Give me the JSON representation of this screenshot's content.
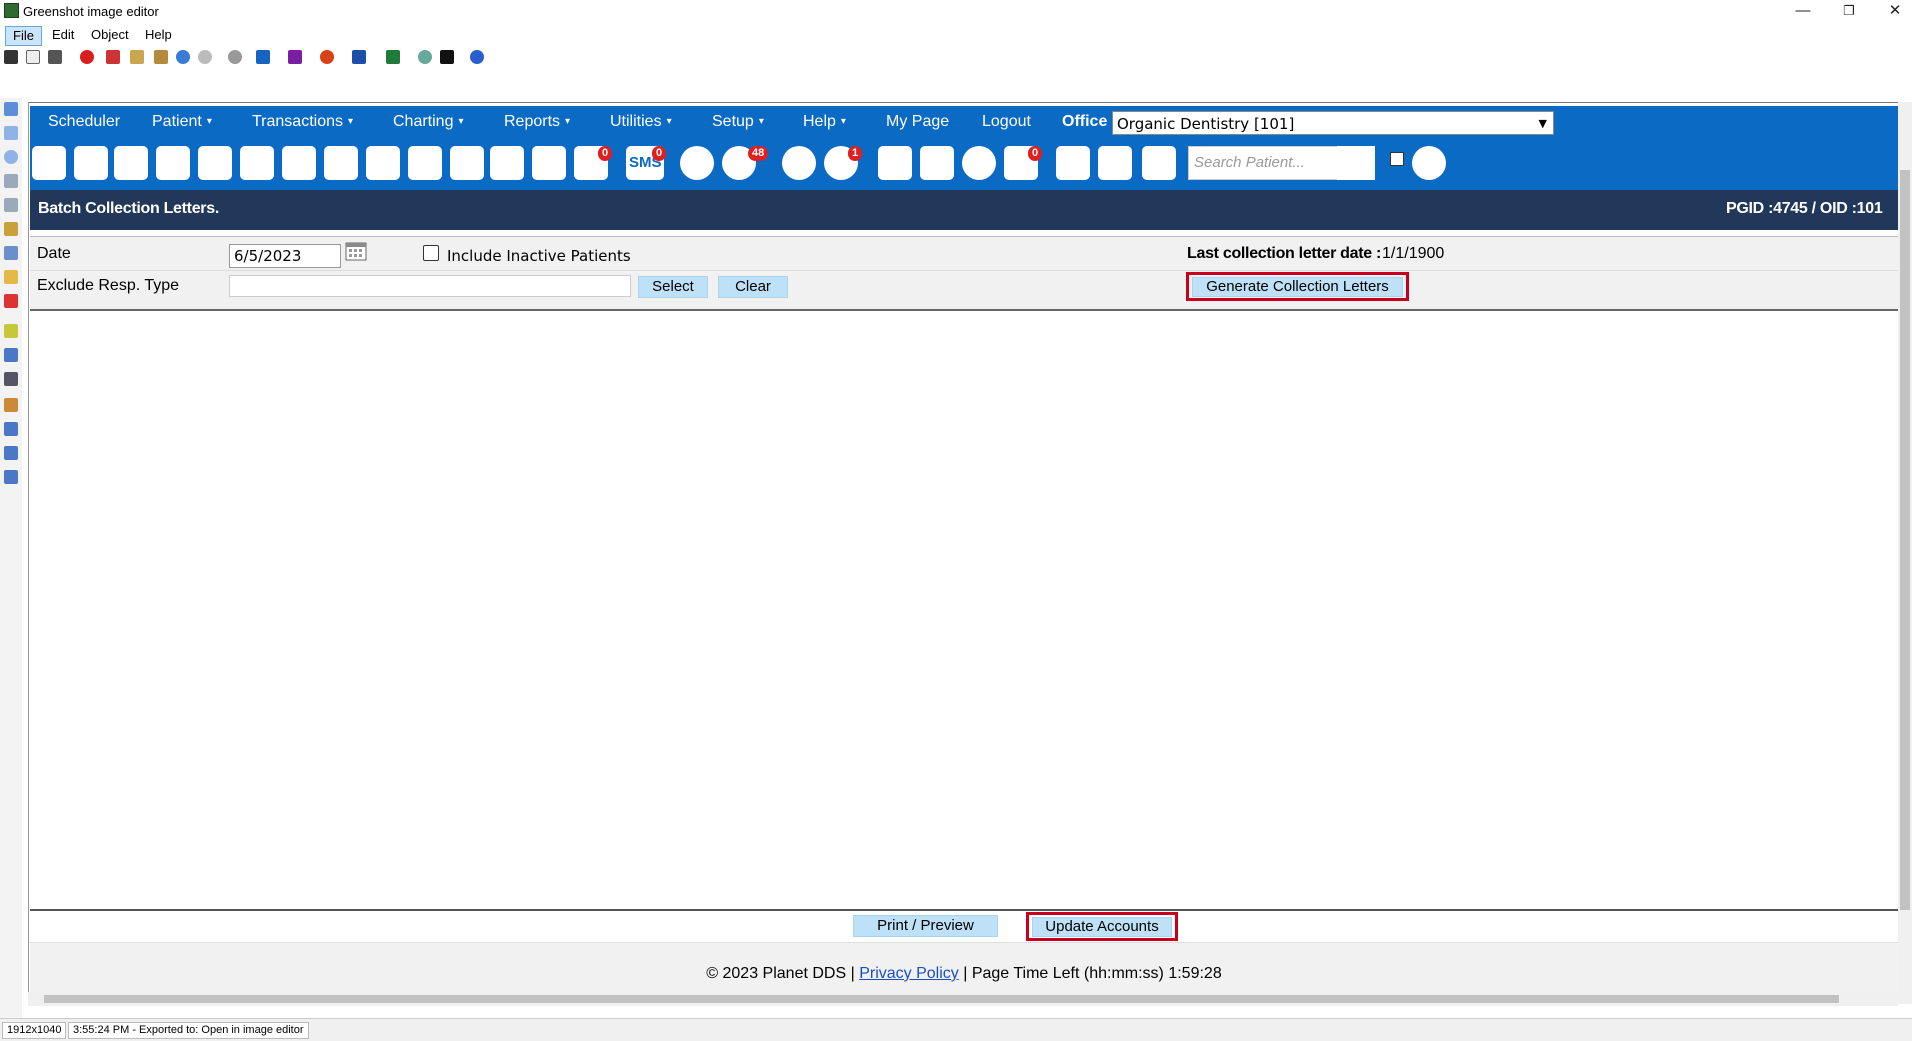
{
  "window": {
    "title": "Greenshot image editor",
    "controls": {
      "minimize": "—",
      "restore": "❐",
      "close": "✕"
    }
  },
  "menubar": {
    "items": [
      "File",
      "Edit",
      "Object",
      "Help"
    ]
  },
  "nav": {
    "items": [
      {
        "label": "Scheduler",
        "dropdown": false
      },
      {
        "label": "Patient",
        "dropdown": true
      },
      {
        "label": "Transactions",
        "dropdown": true
      },
      {
        "label": "Charting",
        "dropdown": true
      },
      {
        "label": "Reports",
        "dropdown": true
      },
      {
        "label": "Utilities",
        "dropdown": true
      },
      {
        "label": "Setup",
        "dropdown": true
      },
      {
        "label": "Help",
        "dropdown": true
      },
      {
        "label": "My Page",
        "dropdown": false
      },
      {
        "label": "Logout",
        "dropdown": false
      }
    ],
    "caret": "▾",
    "office_label": "Office",
    "office_value": "Organic Dentistry [101]"
  },
  "iconbar": {
    "badges": {
      "messages": "0",
      "sms": "0",
      "sms_label": "SMS",
      "web": "48",
      "recall": "1",
      "document": "0"
    },
    "search_placeholder": "Search Patient..."
  },
  "page": {
    "heading": "Batch Collection Letters.",
    "ids": "PGID :4745  /  OID :101"
  },
  "form": {
    "date_label": "Date",
    "date_value": "6/5/2023",
    "include_inactive_label": "Include Inactive Patients",
    "include_inactive_checked": false,
    "last_date_label": "Last collection letter date :",
    "last_date_value": "1/1/1900",
    "exclude_label": "Exclude Resp. Type",
    "exclude_value": "",
    "select_button": "Select",
    "clear_button": "Clear",
    "generate_button": "Generate Collection Letters"
  },
  "actions": {
    "print_preview": "Print / Preview",
    "update_accounts": "Update Accounts"
  },
  "footer": {
    "copyright": "© 2023 Planet DDS |",
    "privacy": "Privacy Policy",
    "time_left": "|  Page Time Left (hh:mm:ss) 1:59:28"
  },
  "statusbar": {
    "size": "1912x1040",
    "message": "3:55:24 PM - Exported to: Open in image editor"
  },
  "colors": {
    "nav_blue": "#0b6ac4",
    "heading_navy": "#22385a",
    "button_blue": "#bfe1f7",
    "highlight_red": "#c8001e"
  }
}
